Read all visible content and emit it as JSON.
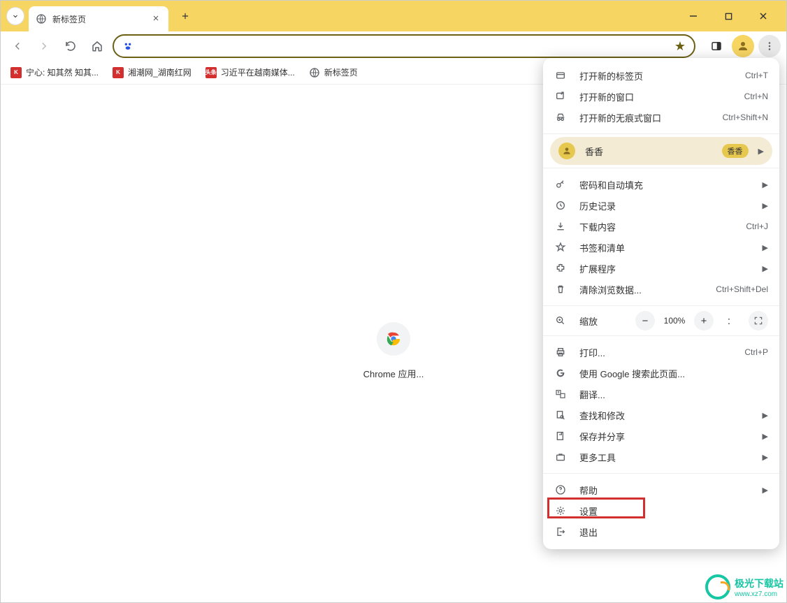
{
  "tab": {
    "title": "新标签页"
  },
  "bookmarks": [
    {
      "label": "宁心: 知其然 知其...",
      "icon": "red-k"
    },
    {
      "label": "湘潮网_湖南红网",
      "icon": "red-k"
    },
    {
      "label": "习近平在越南媒体...",
      "icon": "tou"
    },
    {
      "label": "新标签页",
      "icon": "globe"
    }
  ],
  "shortcut": {
    "label": "Chrome 应用..."
  },
  "menu": {
    "new_tab": "打开新的标签页",
    "new_tab_sc": "Ctrl+T",
    "new_win": "打开新的窗口",
    "new_win_sc": "Ctrl+N",
    "new_incog": "打开新的无痕式窗口",
    "new_incog_sc": "Ctrl+Shift+N",
    "profile_name": "香香",
    "profile_badge": "香香",
    "passwords": "密码和自动填充",
    "history": "历史记录",
    "downloads": "下载内容",
    "downloads_sc": "Ctrl+J",
    "bookmarks": "书签和清单",
    "extensions": "扩展程序",
    "clear_data": "清除浏览数据...",
    "clear_data_sc": "Ctrl+Shift+Del",
    "zoom": "缩放",
    "zoom_val": "100%",
    "print": "打印...",
    "print_sc": "Ctrl+P",
    "search_google": "使用 Google 搜索此页面...",
    "translate": "翻译...",
    "find_edit": "查找和修改",
    "save_share": "保存并分享",
    "more_tools": "更多工具",
    "help": "帮助",
    "settings": "设置",
    "exit": "退出"
  },
  "watermark": {
    "title": "极光下载站",
    "url": "www.xz7.com"
  }
}
